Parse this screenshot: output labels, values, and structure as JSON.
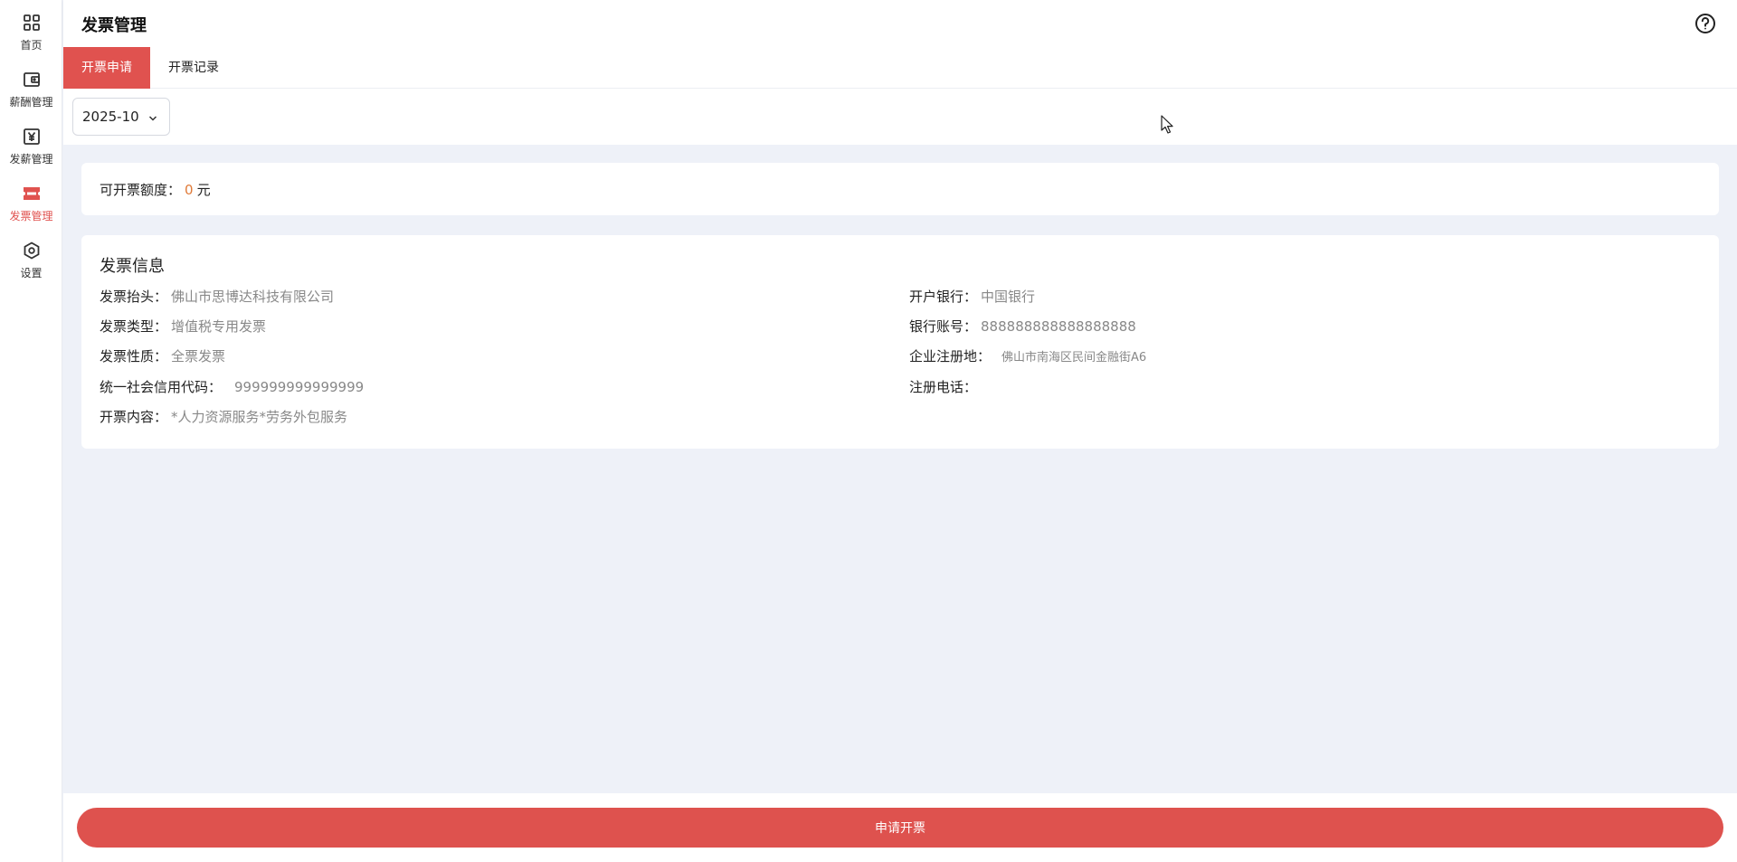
{
  "sidebar": {
    "items": [
      {
        "label": "首页",
        "icon": "grid-icon"
      },
      {
        "label": "薪酬管理",
        "icon": "wallet-icon"
      },
      {
        "label": "发薪管理",
        "icon": "yen-icon"
      },
      {
        "label": "发票管理",
        "icon": "ticket-icon",
        "active": true
      },
      {
        "label": "设置",
        "icon": "hexagon-settings-icon"
      }
    ]
  },
  "header": {
    "title": "发票管理",
    "help_icon": "question-circle-icon"
  },
  "tabs": [
    {
      "label": "开票申请",
      "active": true
    },
    {
      "label": "开票记录",
      "active": false
    }
  ],
  "filter": {
    "month": "2025-10"
  },
  "quota": {
    "label": "可开票额度：",
    "value": "0",
    "unit": "元"
  },
  "invoice_info": {
    "title": "发票信息",
    "left_fields": [
      {
        "key": "发票抬头：",
        "value": "佛山市思博达科技有限公司"
      },
      {
        "key": "发票类型：",
        "value": "增值税专用发票"
      },
      {
        "key": "发票性质：",
        "value": "全票发票"
      },
      {
        "key": "统一社会信用代码：",
        "value": "999999999999999"
      },
      {
        "key": "开票内容：",
        "value": "*人力资源服务*劳务外包服务"
      }
    ],
    "right_fields": [
      {
        "key": "开户银行：",
        "value": "中国银行"
      },
      {
        "key": "银行账号：",
        "value": "888888888888888888"
      },
      {
        "key": "企业注册地：",
        "value": "佛山市南海区民间金融街A6"
      },
      {
        "key": "注册电话：",
        "value": ""
      }
    ]
  },
  "actions": {
    "apply_label": "申请开票"
  },
  "colors": {
    "accent": "#e0524f",
    "quota_number": "#e07b3a",
    "value_text": "#888888"
  }
}
